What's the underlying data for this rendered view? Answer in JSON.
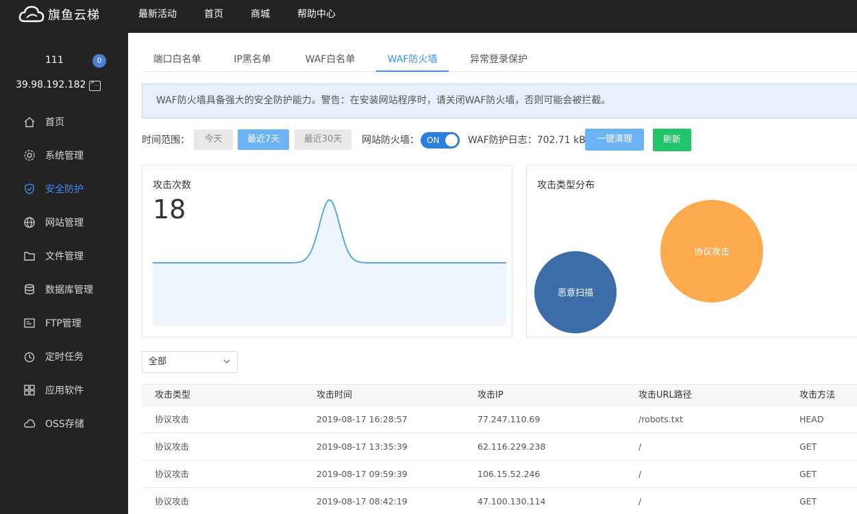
{
  "app": {
    "logo_text": "旗鱼云梯"
  },
  "topnav": [
    "最新活动",
    "首页",
    "商城",
    "帮助中心"
  ],
  "user": {
    "name": "111",
    "badge": "0",
    "ip": "39.98.192.182"
  },
  "sidebar": {
    "items": [
      {
        "label": "首页",
        "icon": "home-icon"
      },
      {
        "label": "系统管理",
        "icon": "gear-icon"
      },
      {
        "label": "安全防护",
        "icon": "shield-icon",
        "active": true
      },
      {
        "label": "网站管理",
        "icon": "globe-icon"
      },
      {
        "label": "文件管理",
        "icon": "folder-icon"
      },
      {
        "label": "数据库管理",
        "icon": "database-icon"
      },
      {
        "label": "FTP管理",
        "icon": "ftp-icon"
      },
      {
        "label": "定时任务",
        "icon": "clock-icon"
      },
      {
        "label": "应用软件",
        "icon": "apps-icon"
      },
      {
        "label": "OSS存储",
        "icon": "cloud-icon"
      }
    ]
  },
  "tabs": [
    "端口白名单",
    "IP黑名单",
    "WAF白名单",
    "WAF防火墙",
    "异常登录保护"
  ],
  "active_tab": "WAF防火墙",
  "notice": "WAF防火墙具备强大的安全防护能力。警告：在安装网站程序时，请关闭WAF防火墙，否则可能会被拦截。",
  "controls": {
    "time_range_label": "时间范围：",
    "ranges": [
      "今天",
      "最近7天",
      "最近30天"
    ],
    "selected_range": "最近7天",
    "firewall_label": "网站防火墙：",
    "firewall_state": "ON",
    "log_label": "WAF防护日志：702.71 kB",
    "clear_button": "一键清理",
    "refresh_button": "刷新"
  },
  "attack_count_panel": {
    "title": "攻击次数",
    "value": "18"
  },
  "attack_type_panel": {
    "title": "攻击类型分布"
  },
  "chart_data": [
    {
      "type": "area",
      "title": "攻击次数",
      "x": [
        1,
        2,
        3,
        4,
        5,
        6,
        7
      ],
      "values": [
        0,
        0,
        0,
        18,
        0,
        0,
        0
      ],
      "color": "#5aa6e0"
    },
    {
      "type": "bubble",
      "title": "攻击类型分布",
      "categories": [
        "恶意扫描",
        "协议攻击"
      ],
      "colors": [
        "#3d6da8",
        "#fbab4d"
      ],
      "relative_size": [
        0.8,
        1.0
      ]
    }
  ],
  "filter": {
    "selected": "全部"
  },
  "table": {
    "headers": [
      "攻击类型",
      "攻击时间",
      "攻击IP",
      "攻击URL路径",
      "攻击方法"
    ],
    "rows": [
      [
        "协议攻击",
        "2019-08-17 16:28:57",
        "77.247.110.69",
        "/robots.txt",
        "HEAD"
      ],
      [
        "协议攻击",
        "2019-08-17 13:35:39",
        "62.116.229.238",
        "/",
        "GET"
      ],
      [
        "协议攻击",
        "2019-08-17 09:59:39",
        "106.15.52.246",
        "/",
        "GET"
      ],
      [
        "协议攻击",
        "2019-08-17 08:42:19",
        "47.100.130.114",
        "/",
        "GET"
      ]
    ]
  }
}
